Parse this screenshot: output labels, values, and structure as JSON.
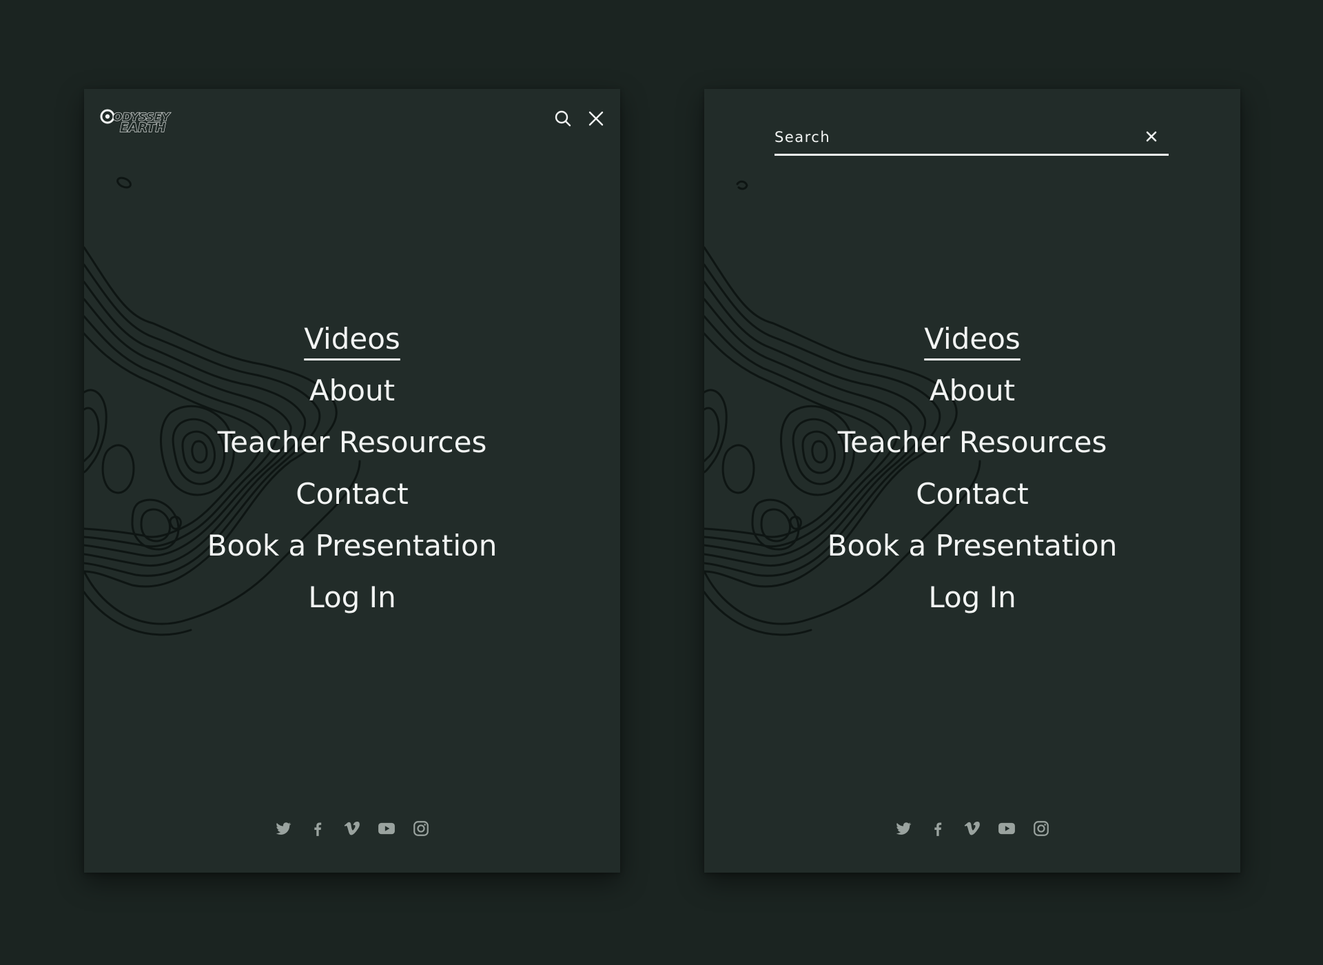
{
  "colors": {
    "page_background": "#1b2421",
    "panel_background": "#222c29",
    "text": "#f2f4f3",
    "social_icon": "#9aa39f",
    "contour_lines": "#0e1513"
  },
  "brand": {
    "logo_line1": "ODYSSEY",
    "logo_line2": "EARTH"
  },
  "left_screen": {
    "header_icons": [
      "search-icon",
      "close-icon"
    ],
    "nav": {
      "items": [
        {
          "label": "Videos",
          "active": true
        },
        {
          "label": "About"
        },
        {
          "label": "Teacher Resources"
        },
        {
          "label": "Contact"
        },
        {
          "label": "Book a Presentation"
        },
        {
          "label": "Log In"
        }
      ]
    }
  },
  "right_screen": {
    "search": {
      "placeholder": "Search",
      "value": "",
      "close_icon": "close-icon"
    },
    "nav": {
      "items": [
        {
          "label": "Videos",
          "active": true
        },
        {
          "label": "About"
        },
        {
          "label": "Teacher Resources"
        },
        {
          "label": "Contact"
        },
        {
          "label": "Book a Presentation"
        },
        {
          "label": "Log In"
        }
      ]
    }
  },
  "social_icons": [
    "twitter-icon",
    "facebook-icon",
    "vimeo-icon",
    "youtube-icon",
    "instagram-icon"
  ]
}
